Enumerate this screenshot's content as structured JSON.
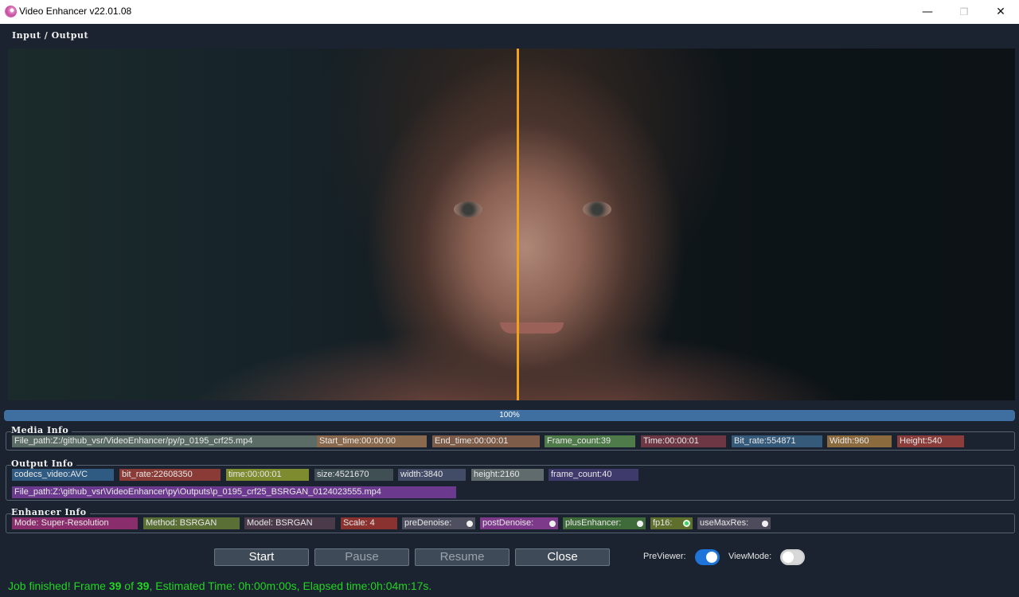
{
  "window": {
    "title": "Video Enhancer v22.01.08",
    "minimize_icon": "—",
    "maximize_icon": "❐",
    "close_icon": "✕"
  },
  "preview": {
    "label": "Input / Output"
  },
  "progress": {
    "value": 1.0,
    "text": "100%",
    "fill_color": "#3e6fa0"
  },
  "media_info": {
    "label": "Media Info",
    "items": [
      "File_path:Z:/github_vsr/VideoEnhancer/py/p_0195_crf25.mp4",
      "Start_time:00:00:00",
      "End_time:00:00:01",
      "Frame_count:39",
      "Time:00:00:01",
      "Bit_rate:554871",
      "Width:960",
      "Height:540"
    ]
  },
  "output_info": {
    "label": "Output Info",
    "items": [
      "codecs_video:AVC",
      "bit_rate:22608350",
      "time:00:00:01",
      "size:4521670",
      "width:3840",
      "height:2160",
      "frame_count:40"
    ],
    "file_path": "File_path:Z:\\github_vsr\\VideoEnhancer\\py\\Outputs\\p_0195_crf25_BSRGAN_0124023555.mp4"
  },
  "enhancer_info": {
    "label": "Enhancer Info",
    "items": [
      "Mode: Super-Resolution",
      "Method: BSRGAN",
      "Model: BSRGAN",
      "Scale: 4"
    ],
    "toggles": [
      {
        "label": "preDenoise:",
        "on": false
      },
      {
        "label": "postDenoise:",
        "on": false
      },
      {
        "label": "plusEnhancer:",
        "on": false
      },
      {
        "label": "fp16:",
        "on": true
      },
      {
        "label": "useMaxRes:",
        "on": false
      }
    ]
  },
  "controls": {
    "start": "Start",
    "pause": "Pause",
    "resume": "Resume",
    "close": "Close",
    "previewer_label": "PreViewer:",
    "previewer_on": true,
    "viewmode_label": "ViewMode:",
    "viewmode_on": false
  },
  "status": {
    "prefix": "Job finished! Frame ",
    "frame": "39",
    "of": " of ",
    "total": "39",
    "suffix": ", Estimated Time: 0h:00m:00s, Elapsed time:0h:04m:17s."
  },
  "colors": {
    "accent_orange": "#f2a11b",
    "status_green": "#23d423",
    "toggle_on": "#1e74d8"
  }
}
